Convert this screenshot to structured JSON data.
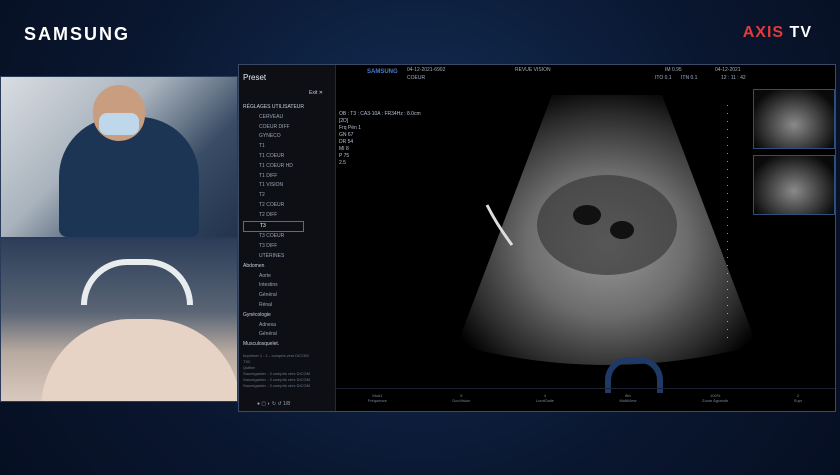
{
  "brand": {
    "left": "SAMSUNG",
    "right_a": "AXIS",
    "right_b": "TV"
  },
  "preset": {
    "title": "Preset",
    "exit": "Exit",
    "items": [
      {
        "label": "RÉGLAGES UTILISATEUR",
        "kind": "grp"
      },
      {
        "label": "CERVEAU",
        "kind": "sub"
      },
      {
        "label": "COEUR DIFF",
        "kind": "sub"
      },
      {
        "label": "GYNECO",
        "kind": "sub"
      },
      {
        "label": "T1",
        "kind": "sub"
      },
      {
        "label": "T1 COEUR",
        "kind": "sub"
      },
      {
        "label": "T1 COEUR HD",
        "kind": "sub"
      },
      {
        "label": "T1 DIFF",
        "kind": "sub"
      },
      {
        "label": "T1 VISION",
        "kind": "sub"
      },
      {
        "label": "T2",
        "kind": "sub"
      },
      {
        "label": "T2 COEUR",
        "kind": "sub"
      },
      {
        "label": "T2 DIFF",
        "kind": "sub"
      },
      {
        "label": "T3",
        "kind": "sub sel"
      },
      {
        "label": "T3 COEUR",
        "kind": "sub"
      },
      {
        "label": "T3 DIFF",
        "kind": "sub"
      },
      {
        "label": "UTÉRINES",
        "kind": "sub"
      },
      {
        "label": "Abdomen",
        "kind": "grp"
      },
      {
        "label": "Aorte",
        "kind": "sub"
      },
      {
        "label": "Intestins",
        "kind": "sub"
      },
      {
        "label": "Général",
        "kind": "sub"
      },
      {
        "label": "Rénal",
        "kind": "sub"
      },
      {
        "label": "Gynécologie",
        "kind": "grp"
      },
      {
        "label": "Adnexa",
        "kind": "sub"
      },
      {
        "label": "Général",
        "kind": "sub"
      },
      {
        "label": "Musculosquelet.",
        "kind": "grp"
      }
    ],
    "history": [
      "Imprimer 1 - 1 - compris vers DICOM",
      "T3C",
      "Quitter",
      "Sauvegarder - 3 compris vers DICOM",
      "Sauvegarder - 3 compris vers DICOM",
      "Sauvegarder - 3 compris vers DICOM"
    ],
    "ctrl": "1/8"
  },
  "header": {
    "date_id": "04-12-2021-6902",
    "mode": "COEUR",
    "review": "REVUE VISION",
    "im": "IM 0.95",
    "ito": "ITO 0.1",
    "itn": "ITN 0.1",
    "date": "04-12-2021",
    "time": "12 : 11 : 42",
    "samsung": "SAMSUNG"
  },
  "params": {
    "line1": "OB : T3 : CA3-10A : FR34Hz : 8.0cm",
    "line2": "[2D]",
    "rows": [
      "Frq  Pén 1",
      "GN   67",
      "DR   54",
      "MI   8",
      "P    75",
      "2.5"
    ]
  },
  "bottom": [
    "Mod1\nFréquence",
    "5\nDocVision",
    "4\nLumiGalie",
    "8th\nMultiView",
    "100%\nZoom Agrandir",
    "2\nSupr"
  ],
  "colors": {
    "accent": "#e23b3b",
    "bg": "#0b1a33"
  }
}
